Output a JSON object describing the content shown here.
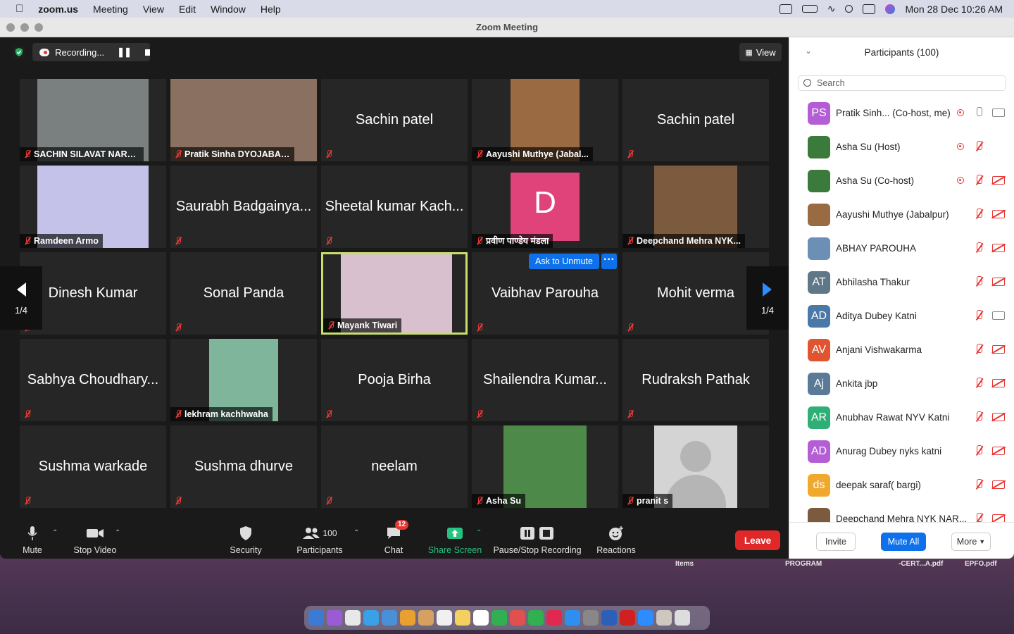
{
  "menubar": {
    "apple": "",
    "app": "zoom.us",
    "items": [
      "Meeting",
      "View",
      "Edit",
      "Window",
      "Help"
    ],
    "clock": "Mon 28 Dec  10:26 AM"
  },
  "window": {
    "title": "Zoom Meeting"
  },
  "recording": {
    "label": "Recording..."
  },
  "view_button": {
    "label": "View"
  },
  "tiles": [
    {
      "name": "SACHIN SILAVAT NARS...",
      "kind": "label",
      "pic": "#7a8080"
    },
    {
      "name": "Pratik Sinha DYOJABAL...",
      "kind": "label",
      "pic": "#8a7060"
    },
    {
      "name": "Sachin patel",
      "kind": "text"
    },
    {
      "name": "Aayushi Muthye (Jabal...",
      "kind": "label",
      "pic": "#9a6b42"
    },
    {
      "name": "Sachin patel",
      "kind": "text"
    },
    {
      "name": "Ramdeen Armo",
      "kind": "label",
      "pic": "#c4c2e8"
    },
    {
      "name": "Saurabh Badgainya...",
      "kind": "text"
    },
    {
      "name": "Sheetal kumar Kach...",
      "kind": "text"
    },
    {
      "name": "प्रवीण पाण्डेय मंडला",
      "kind": "label",
      "pic": "#e0427a",
      "letter": "D"
    },
    {
      "name": "Deepchand Mehra NYK...",
      "kind": "label",
      "pic": "#7c5a3e"
    },
    {
      "name": "Dinesh Kumar",
      "kind": "text"
    },
    {
      "name": "Sonal Panda",
      "kind": "text"
    },
    {
      "name": "Mayank Tiwari",
      "kind": "label",
      "pic": "#d8c0cf",
      "active": true
    },
    {
      "name": "Vaibhav Parouha",
      "kind": "text"
    },
    {
      "name": "Mohit verma",
      "kind": "text"
    },
    {
      "name": "Sabhya Choudhary...",
      "kind": "text"
    },
    {
      "name": "lekhram kachhwaha",
      "kind": "label",
      "pic": "#7fb59a"
    },
    {
      "name": "Pooja Birha",
      "kind": "text"
    },
    {
      "name": "Shailendra Kumar...",
      "kind": "text"
    },
    {
      "name": "Rudraksh Pathak",
      "kind": "text"
    },
    {
      "name": "Sushma warkade",
      "kind": "text"
    },
    {
      "name": "Sushma dhurve",
      "kind": "text"
    },
    {
      "name": "neelam",
      "kind": "text"
    },
    {
      "name": "Asha Su",
      "kind": "label",
      "pic": "#4d8a4a"
    },
    {
      "name": "pranit s",
      "kind": "label",
      "pic": "#d4d4d4"
    }
  ],
  "nav": {
    "left_page": "1/4",
    "right_page": "1/4"
  },
  "ask_to_unmute": "Ask to Unmute",
  "toolbar": {
    "mute": "Mute",
    "stop_video": "Stop Video",
    "security": "Security",
    "participants": "Participants",
    "participants_count": "100",
    "chat": "Chat",
    "chat_badge": "12",
    "share_screen": "Share Screen",
    "recording": "Pause/Stop Recording",
    "reactions": "Reactions",
    "leave": "Leave"
  },
  "panel": {
    "title": "Participants (100)",
    "search_placeholder": "Search",
    "participants": [
      {
        "initials": "PS",
        "color": "#b45ed6",
        "name": "Pratik Sinh...  (Co-host, me)",
        "rec": true,
        "mic": "on",
        "cam": "on"
      },
      {
        "initials": "",
        "color": "#3a7a3a",
        "name": "Asha Su (Host)",
        "rec": true,
        "mic": "off",
        "cam": "none"
      },
      {
        "initials": "",
        "color": "#3a7a3a",
        "name": "Asha Su (Co-host)",
        "rec": true,
        "mic": "off",
        "cam": "off"
      },
      {
        "initials": "",
        "color": "#9a6b42",
        "name": "Aayushi Muthye (Jabalpur)",
        "rec": false,
        "mic": "off",
        "cam": "off"
      },
      {
        "initials": "",
        "color": "#6b8fb5",
        "name": "ABHAY PAROUHA",
        "rec": false,
        "mic": "off",
        "cam": "off"
      },
      {
        "initials": "AT",
        "color": "#5f7786",
        "name": "Abhilasha Thakur",
        "rec": false,
        "mic": "off",
        "cam": "off"
      },
      {
        "initials": "AD",
        "color": "#4a79a8",
        "name": "Aditya Dubey Katni",
        "rec": false,
        "mic": "off",
        "cam": "on"
      },
      {
        "initials": "AV",
        "color": "#e0552f",
        "name": "Anjani Vishwakarma",
        "rec": false,
        "mic": "off",
        "cam": "off"
      },
      {
        "initials": "Aj",
        "color": "#5a7a98",
        "name": "Ankita jbp",
        "rec": false,
        "mic": "off",
        "cam": "off"
      },
      {
        "initials": "AR",
        "color": "#2fae76",
        "name": "Anubhav Rawat NYV Katni",
        "rec": false,
        "mic": "off",
        "cam": "off"
      },
      {
        "initials": "AD",
        "color": "#b45ed6",
        "name": "Anurag Dubey nyks katni",
        "rec": false,
        "mic": "off",
        "cam": "off"
      },
      {
        "initials": "ds",
        "color": "#f0a92c",
        "name": "deepak saraf( bargi)",
        "rec": false,
        "mic": "off",
        "cam": "off"
      },
      {
        "initials": "",
        "color": "#7c5a3e",
        "name": "Deepchand Mehra NYK NAR...",
        "rec": false,
        "mic": "off",
        "cam": "off"
      }
    ],
    "invite": "Invite",
    "mute_all": "Mute All",
    "more": "More"
  },
  "desktop_files": [
    "Items",
    "PROGRAM",
    "-CERT...A.pdf",
    "EPFO.pdf"
  ],
  "dock_colors": [
    "#3b7bd4",
    "#9b5bd6",
    "#e8e8e8",
    "#3aa0e8",
    "#4a90d9",
    "#e8a030",
    "#d8a060",
    "#f0f0f0",
    "#f5d060",
    "#ffffff",
    "#30b050",
    "#e05050",
    "#30b050",
    "#e02850",
    "#2e8ff0",
    "#888888",
    "#2b5fb8",
    "#d02020",
    "#2d8cff",
    "#ccc8c0",
    "#dddddd"
  ]
}
